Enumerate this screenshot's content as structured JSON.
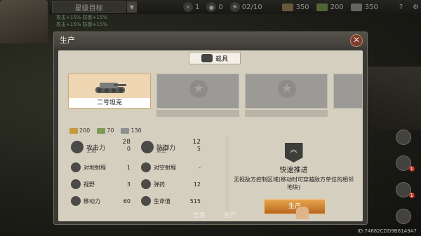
{
  "topbar": {
    "target_label": "星级目标",
    "stat1": "1",
    "stat2": "0",
    "units": "02/10",
    "res1": "350",
    "res2": "200",
    "res3": "350",
    "help": "?"
  },
  "bonuses": [
    "攻击+15%",
    "防御+15%",
    "攻击+15%",
    "防御+15%"
  ],
  "modal": {
    "title": "生产",
    "tab_label": "载具",
    "units": [
      {
        "name": "二号坦克",
        "selected": true
      },
      {
        "name": ""
      },
      {
        "name": ""
      },
      {
        "name": ""
      }
    ],
    "costs": [
      "200",
      "70",
      "130"
    ],
    "stats": {
      "attack_label": "攻击力",
      "attack_sub": "主炮",
      "attack_val1": "28",
      "attack_val2": "0",
      "defense_label": "防御力",
      "defense_sub": "重型",
      "defense_val1": "12",
      "defense_val2": "5",
      "ground_label": "对地射程",
      "ground_val": "1",
      "air_label": "对空射程",
      "air_val": "-",
      "vision_label": "视野",
      "vision_val": "3",
      "ammo_label": "弹药",
      "ammo_val": "12",
      "move_label": "移动力",
      "move_val": "60",
      "hp_label": "生命值",
      "hp_val": "515"
    },
    "ability": {
      "title": "快速推进",
      "desc": "无视敌方控制区域(移动时可穿越敌方单位的相邻地块)",
      "badge_icon": "chevron-rank-icon"
    },
    "produce_label": "生产"
  },
  "bottom": {
    "info": "信息",
    "produce": "生产"
  },
  "id_text": "ID:74682CDD9B61A9A7",
  "side_badge1": "1",
  "side_badge2": "1",
  "colors": {
    "accent": "#e7a64e",
    "panel": "#d5cfbf",
    "selected_card": "#f0d7b4",
    "close": "#7a3c2e"
  }
}
